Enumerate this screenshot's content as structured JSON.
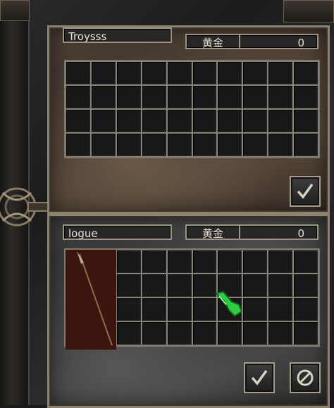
{
  "trade": {
    "other_player": {
      "name": "Troysss",
      "gold_label": "黄金",
      "gold_value": "0",
      "grid": {
        "columns": 10,
        "rows": 4
      },
      "accept_icon": "checkmark-icon"
    },
    "self_player": {
      "name": "logue",
      "gold_label": "黄金",
      "gold_value": "0",
      "grid": {
        "columns": 10,
        "rows": 4
      },
      "items": [
        {
          "name": "spear",
          "icon": "spear-icon",
          "col": 0,
          "row": 0,
          "w": 2,
          "h": 4
        }
      ],
      "accept_icon": "checkmark-icon",
      "cancel_icon": "cancel-icon"
    },
    "cursor_icon": "glove-cursor-icon",
    "colors": {
      "gold_text": "#e8e2d2",
      "frame": "#9c9382",
      "item_bg": "#3d150f",
      "cursor": "#2ecc40"
    }
  }
}
